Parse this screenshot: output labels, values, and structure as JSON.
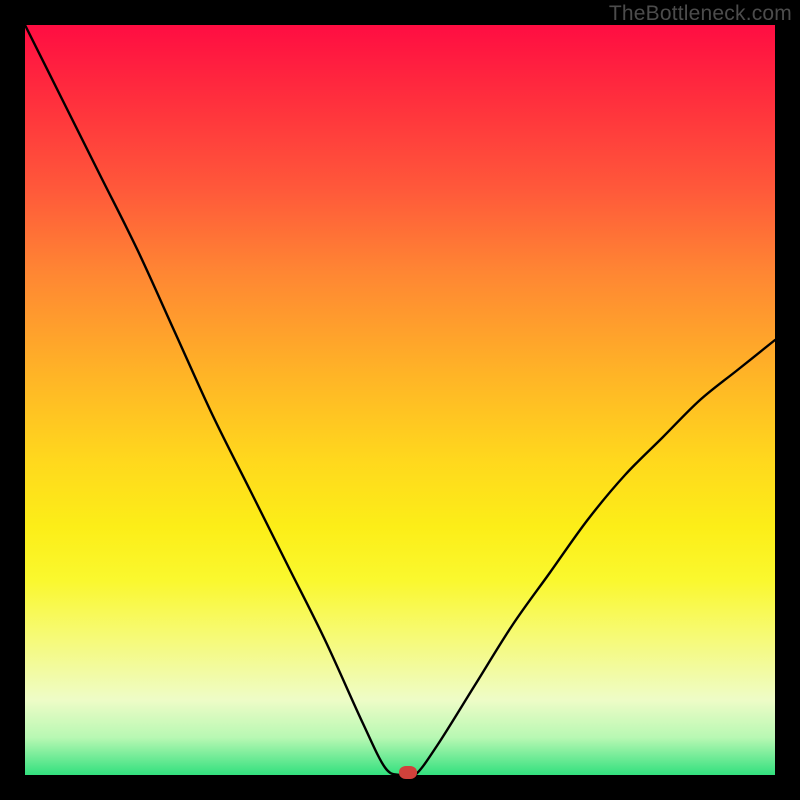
{
  "watermark": "TheBottleneck.com",
  "chart_data": {
    "type": "line",
    "title": "",
    "xlabel": "",
    "ylabel": "",
    "xlim": [
      0,
      100
    ],
    "ylim": [
      0,
      100
    ],
    "series": [
      {
        "name": "bottleneck-curve",
        "x": [
          0,
          5,
          10,
          15,
          20,
          25,
          30,
          35,
          40,
          45,
          48,
          50,
          52,
          55,
          60,
          65,
          70,
          75,
          80,
          85,
          90,
          95,
          100
        ],
        "values": [
          100,
          90,
          80,
          70,
          59,
          48,
          38,
          28,
          18,
          7,
          1,
          0,
          0,
          4,
          12,
          20,
          27,
          34,
          40,
          45,
          50,
          54,
          58
        ]
      }
    ],
    "marker": {
      "x": 51,
      "y": 0,
      "color": "#d0413b"
    },
    "background_gradient": {
      "direction": "top-to-bottom",
      "stops": [
        {
          "pos": 0,
          "color": "#ff0d42"
        },
        {
          "pos": 50,
          "color": "#ffc021"
        },
        {
          "pos": 75,
          "color": "#fcf61e"
        },
        {
          "pos": 100,
          "color": "#32e07e"
        }
      ]
    }
  }
}
